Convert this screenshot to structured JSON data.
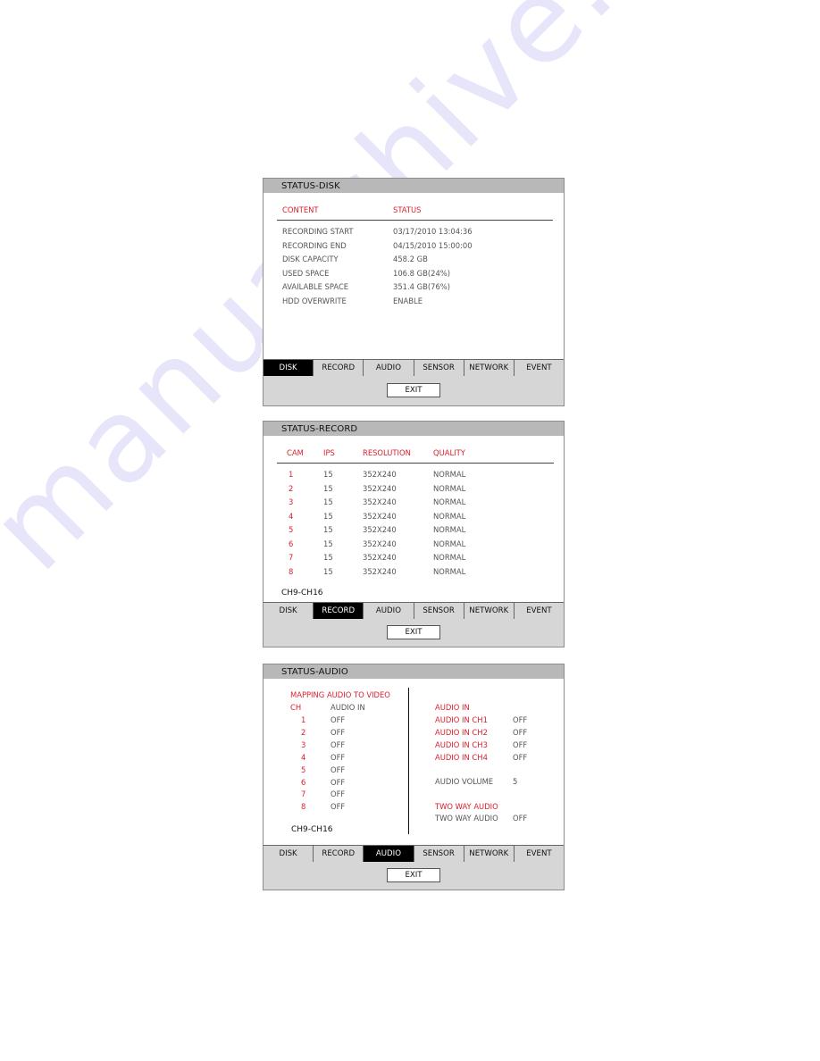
{
  "tabs": [
    "DISK",
    "RECORD",
    "AUDIO",
    "SENSOR",
    "NETWORK",
    "EVENT"
  ],
  "exit_label": "EXIT",
  "disk": {
    "title": "STATUS-DISK",
    "active_tab": "DISK",
    "headers": {
      "content": "CONTENT",
      "status": "STATUS"
    },
    "rows": [
      {
        "label": "RECORDING START",
        "value": "03/17/2010 13:04:36"
      },
      {
        "label": "RECORDING END",
        "value": "04/15/2010 15:00:00"
      },
      {
        "label": "DISK CAPACITY",
        "value": "458.2 GB"
      },
      {
        "label": "USED SPACE",
        "value": "106.8 GB(24%)"
      },
      {
        "label": "AVAILABLE SPACE",
        "value": "351.4 GB(76%)"
      },
      {
        "label": "HDD OVERWRITE",
        "value": "ENABLE"
      }
    ]
  },
  "record": {
    "title": "STATUS-RECORD",
    "active_tab": "RECORD",
    "headers": {
      "cam": "CAM",
      "ips": "IPS",
      "resolution": "RESOLUTION",
      "quality": "QUALITY"
    },
    "rows": [
      {
        "cam": "1",
        "ips": "15",
        "resolution": "352X240",
        "quality": "NORMAL"
      },
      {
        "cam": "2",
        "ips": "15",
        "resolution": "352X240",
        "quality": "NORMAL"
      },
      {
        "cam": "3",
        "ips": "15",
        "resolution": "352X240",
        "quality": "NORMAL"
      },
      {
        "cam": "4",
        "ips": "15",
        "resolution": "352X240",
        "quality": "NORMAL"
      },
      {
        "cam": "5",
        "ips": "15",
        "resolution": "352X240",
        "quality": "NORMAL"
      },
      {
        "cam": "6",
        "ips": "15",
        "resolution": "352X240",
        "quality": "NORMAL"
      },
      {
        "cam": "7",
        "ips": "15",
        "resolution": "352X240",
        "quality": "NORMAL"
      },
      {
        "cam": "8",
        "ips": "15",
        "resolution": "352X240",
        "quality": "NORMAL"
      }
    ],
    "page_link": "CH9-CH16"
  },
  "audio": {
    "title": "STATUS-AUDIO",
    "active_tab": "AUDIO",
    "mapping_title": "MAPPING AUDIO TO VIDEO",
    "mapping_headers": {
      "ch": "CH",
      "audio_in": "AUDIO IN"
    },
    "mapping_rows": [
      {
        "ch": "1",
        "value": "OFF"
      },
      {
        "ch": "2",
        "value": "OFF"
      },
      {
        "ch": "3",
        "value": "OFF"
      },
      {
        "ch": "4",
        "value": "OFF"
      },
      {
        "ch": "5",
        "value": "OFF"
      },
      {
        "ch": "6",
        "value": "OFF"
      },
      {
        "ch": "7",
        "value": "OFF"
      },
      {
        "ch": "8",
        "value": "OFF"
      }
    ],
    "page_link": "CH9-CH16",
    "audio_in_title": "AUDIO IN",
    "audio_in_rows": [
      {
        "label": "AUDIO IN CH1",
        "value": "OFF"
      },
      {
        "label": "AUDIO IN CH2",
        "value": "OFF"
      },
      {
        "label": "AUDIO IN CH3",
        "value": "OFF"
      },
      {
        "label": "AUDIO IN CH4",
        "value": "OFF"
      }
    ],
    "volume_label": "AUDIO VOLUME",
    "volume_value": "5",
    "two_way_title": "TWO WAY AUDIO",
    "two_way_label": "TWO WAY AUDIO",
    "two_way_value": "OFF"
  },
  "watermark": "manualshive.com"
}
